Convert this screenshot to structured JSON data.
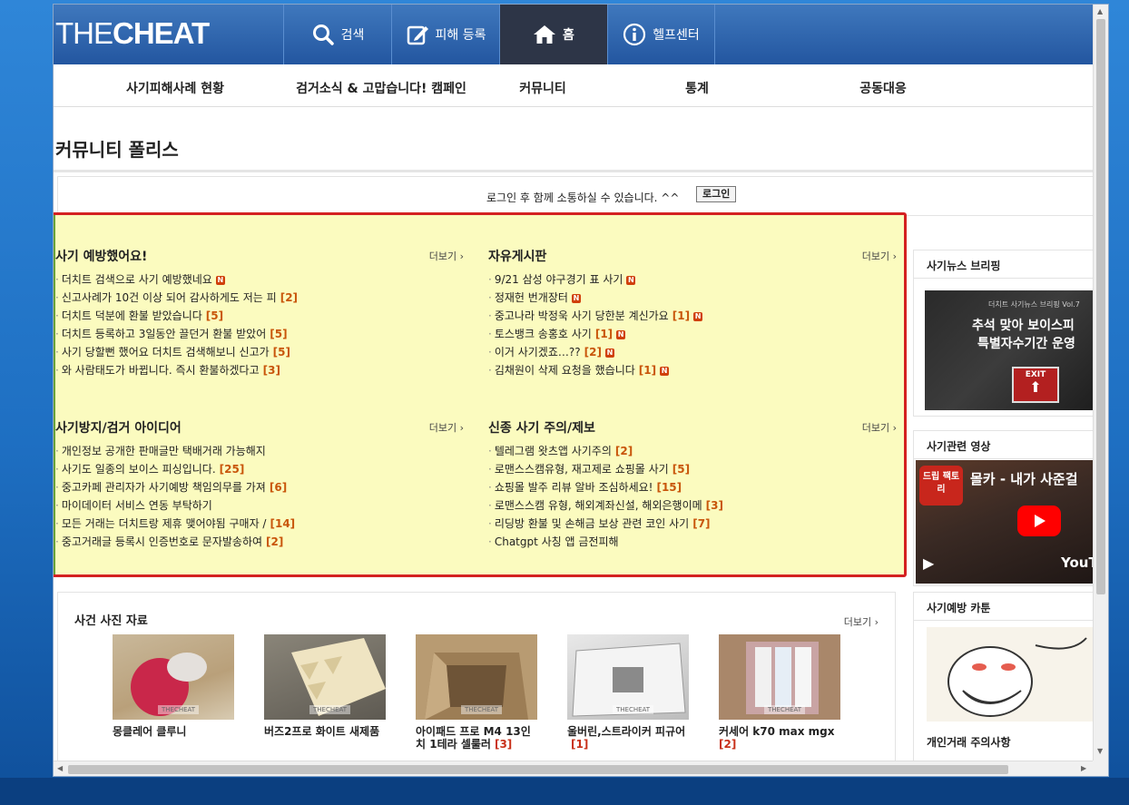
{
  "header": {
    "logo_bold": "THE",
    "logo_rest": "CHEAT",
    "nav": [
      {
        "label": "검색",
        "icon": "search-icon"
      },
      {
        "label": "피해 등록",
        "icon": "edit-icon"
      },
      {
        "label": "홈",
        "icon": "home-icon"
      },
      {
        "label": "헬프센터",
        "icon": "info-icon"
      }
    ]
  },
  "menu": [
    "사기피해사례 현황",
    "검거소식 & 고맙습니다! 캠페인",
    "커뮤니티",
    "통계",
    "공동대응"
  ],
  "page_title": "커뮤니티 폴리스",
  "login": {
    "text": "로그인 후 함께 소통하실 수 있습니다. ^^",
    "button": "로그인"
  },
  "more_label": "더보기",
  "boards": [
    {
      "title": "사기 예방했어요!",
      "posts": [
        {
          "text": "더치트 검색으로 사기 예방했네요",
          "count": "",
          "new": true
        },
        {
          "text": "신고사례가 10건 이상 되어 감사하게도 저는 피",
          "count": "[2]",
          "new": false
        },
        {
          "text": "더치트 덕분에 환불 받았습니다",
          "count": "[5]",
          "new": false
        },
        {
          "text": "더치트 등록하고 3일동안 끌던거 환불 받았어",
          "count": "[5]",
          "new": false
        },
        {
          "text": "사기 당할뻔 했어요 더치트 검색해보니 신고가",
          "count": "[5]",
          "new": false
        },
        {
          "text": "와 사람태도가 바뀝니다. 즉시 환불하겠다고",
          "count": "[3]",
          "new": false
        }
      ]
    },
    {
      "title": "자유게시판",
      "posts": [
        {
          "text": "9/21 삼성 야구경기 표 사기",
          "count": "",
          "new": true
        },
        {
          "text": "정재헌 번개장터",
          "count": "",
          "new": true
        },
        {
          "text": "중고나라 박정욱 사기 당한분 계신가요",
          "count": "[1]",
          "new": true
        },
        {
          "text": "토스뱅크 송홍호 사기",
          "count": "[1]",
          "new": true
        },
        {
          "text": "이거 사기겠죠…??",
          "count": "[2]",
          "new": true
        },
        {
          "text": "김채원이 삭제 요청을 했습니다",
          "count": "[1]",
          "new": true
        }
      ]
    },
    {
      "title": "사기방지/검거 아이디어",
      "posts": [
        {
          "text": "개인정보 공개한 판매글만 택배거래 가능해지",
          "count": "",
          "new": false
        },
        {
          "text": "사기도 일종의 보이스 피싱입니다.",
          "count": "[25]",
          "new": false
        },
        {
          "text": "중고카페 관리자가 사기예방 책임의무를 가져",
          "count": "[6]",
          "new": false
        },
        {
          "text": "마이데이터 서비스 연동 부탁하기",
          "count": "",
          "new": false
        },
        {
          "text": "모든 거래는 더치트랑 제휴 맺어야됨 구매자 /",
          "count": "[14]",
          "new": false
        },
        {
          "text": "중고거래글 등록시 인증번호로 문자발송하여",
          "count": "[2]",
          "new": false
        }
      ]
    },
    {
      "title": "신종 사기 주의/제보",
      "posts": [
        {
          "text": "텔레그램 왓츠앱 사기주의",
          "count": "[2]",
          "new": false
        },
        {
          "text": "로맨스스캠유형, 재고제로 쇼핑몰 사기",
          "count": "[5]",
          "new": false
        },
        {
          "text": "쇼핑몰 발주 리뷰 알바 조심하세요!",
          "count": "[15]",
          "new": false
        },
        {
          "text": "로맨스스캠 유형, 해외계좌신설, 해외은행이메",
          "count": "[3]",
          "new": false
        },
        {
          "text": "리딩방 환불 및 손해금 보상 관련 코인 사기",
          "count": "[7]",
          "new": false
        },
        {
          "text": "Chatgpt 사칭 앱 금전피해",
          "count": "",
          "new": false
        }
      ]
    }
  ],
  "sidebar": {
    "news_title": "사기뉴스 브리핑",
    "news_banner_top": "더치트 사기뉴스 브리핑 Vol.7",
    "news_banner_line1": "추석 맞아 보이스피",
    "news_banner_line2": "특별자수기간 운영",
    "news_banner_exit": "EXIT",
    "video_title": "사기관련 영상",
    "video_badge": "드립 팩토리",
    "video_title_text": "몰카 - 내가 사준걸",
    "video_brand": "YouTu",
    "cartoon_title": "사기예방 카툰",
    "cartoon_caption": "개인거래 주의사항"
  },
  "photos": {
    "title": "사건 사진 자료",
    "watermark": "THECHEAT",
    "items": [
      {
        "caption": "몽클레어 클루니",
        "count": ""
      },
      {
        "caption": "버즈2프로 화이트 새제품",
        "count": ""
      },
      {
        "caption": "아이패드 프로 M4 13인치 1테라 셀룰러",
        "count": "[3]"
      },
      {
        "caption": "울버린,스트라이커 피규어",
        "count": "[1]"
      },
      {
        "caption": "커세어 k70 max mgx",
        "count": "[2]"
      }
    ]
  },
  "colors": {
    "accent": "#2356a0",
    "highlight": "#fbfbbf",
    "border_red": "#d42121",
    "count": "#c8550a"
  }
}
